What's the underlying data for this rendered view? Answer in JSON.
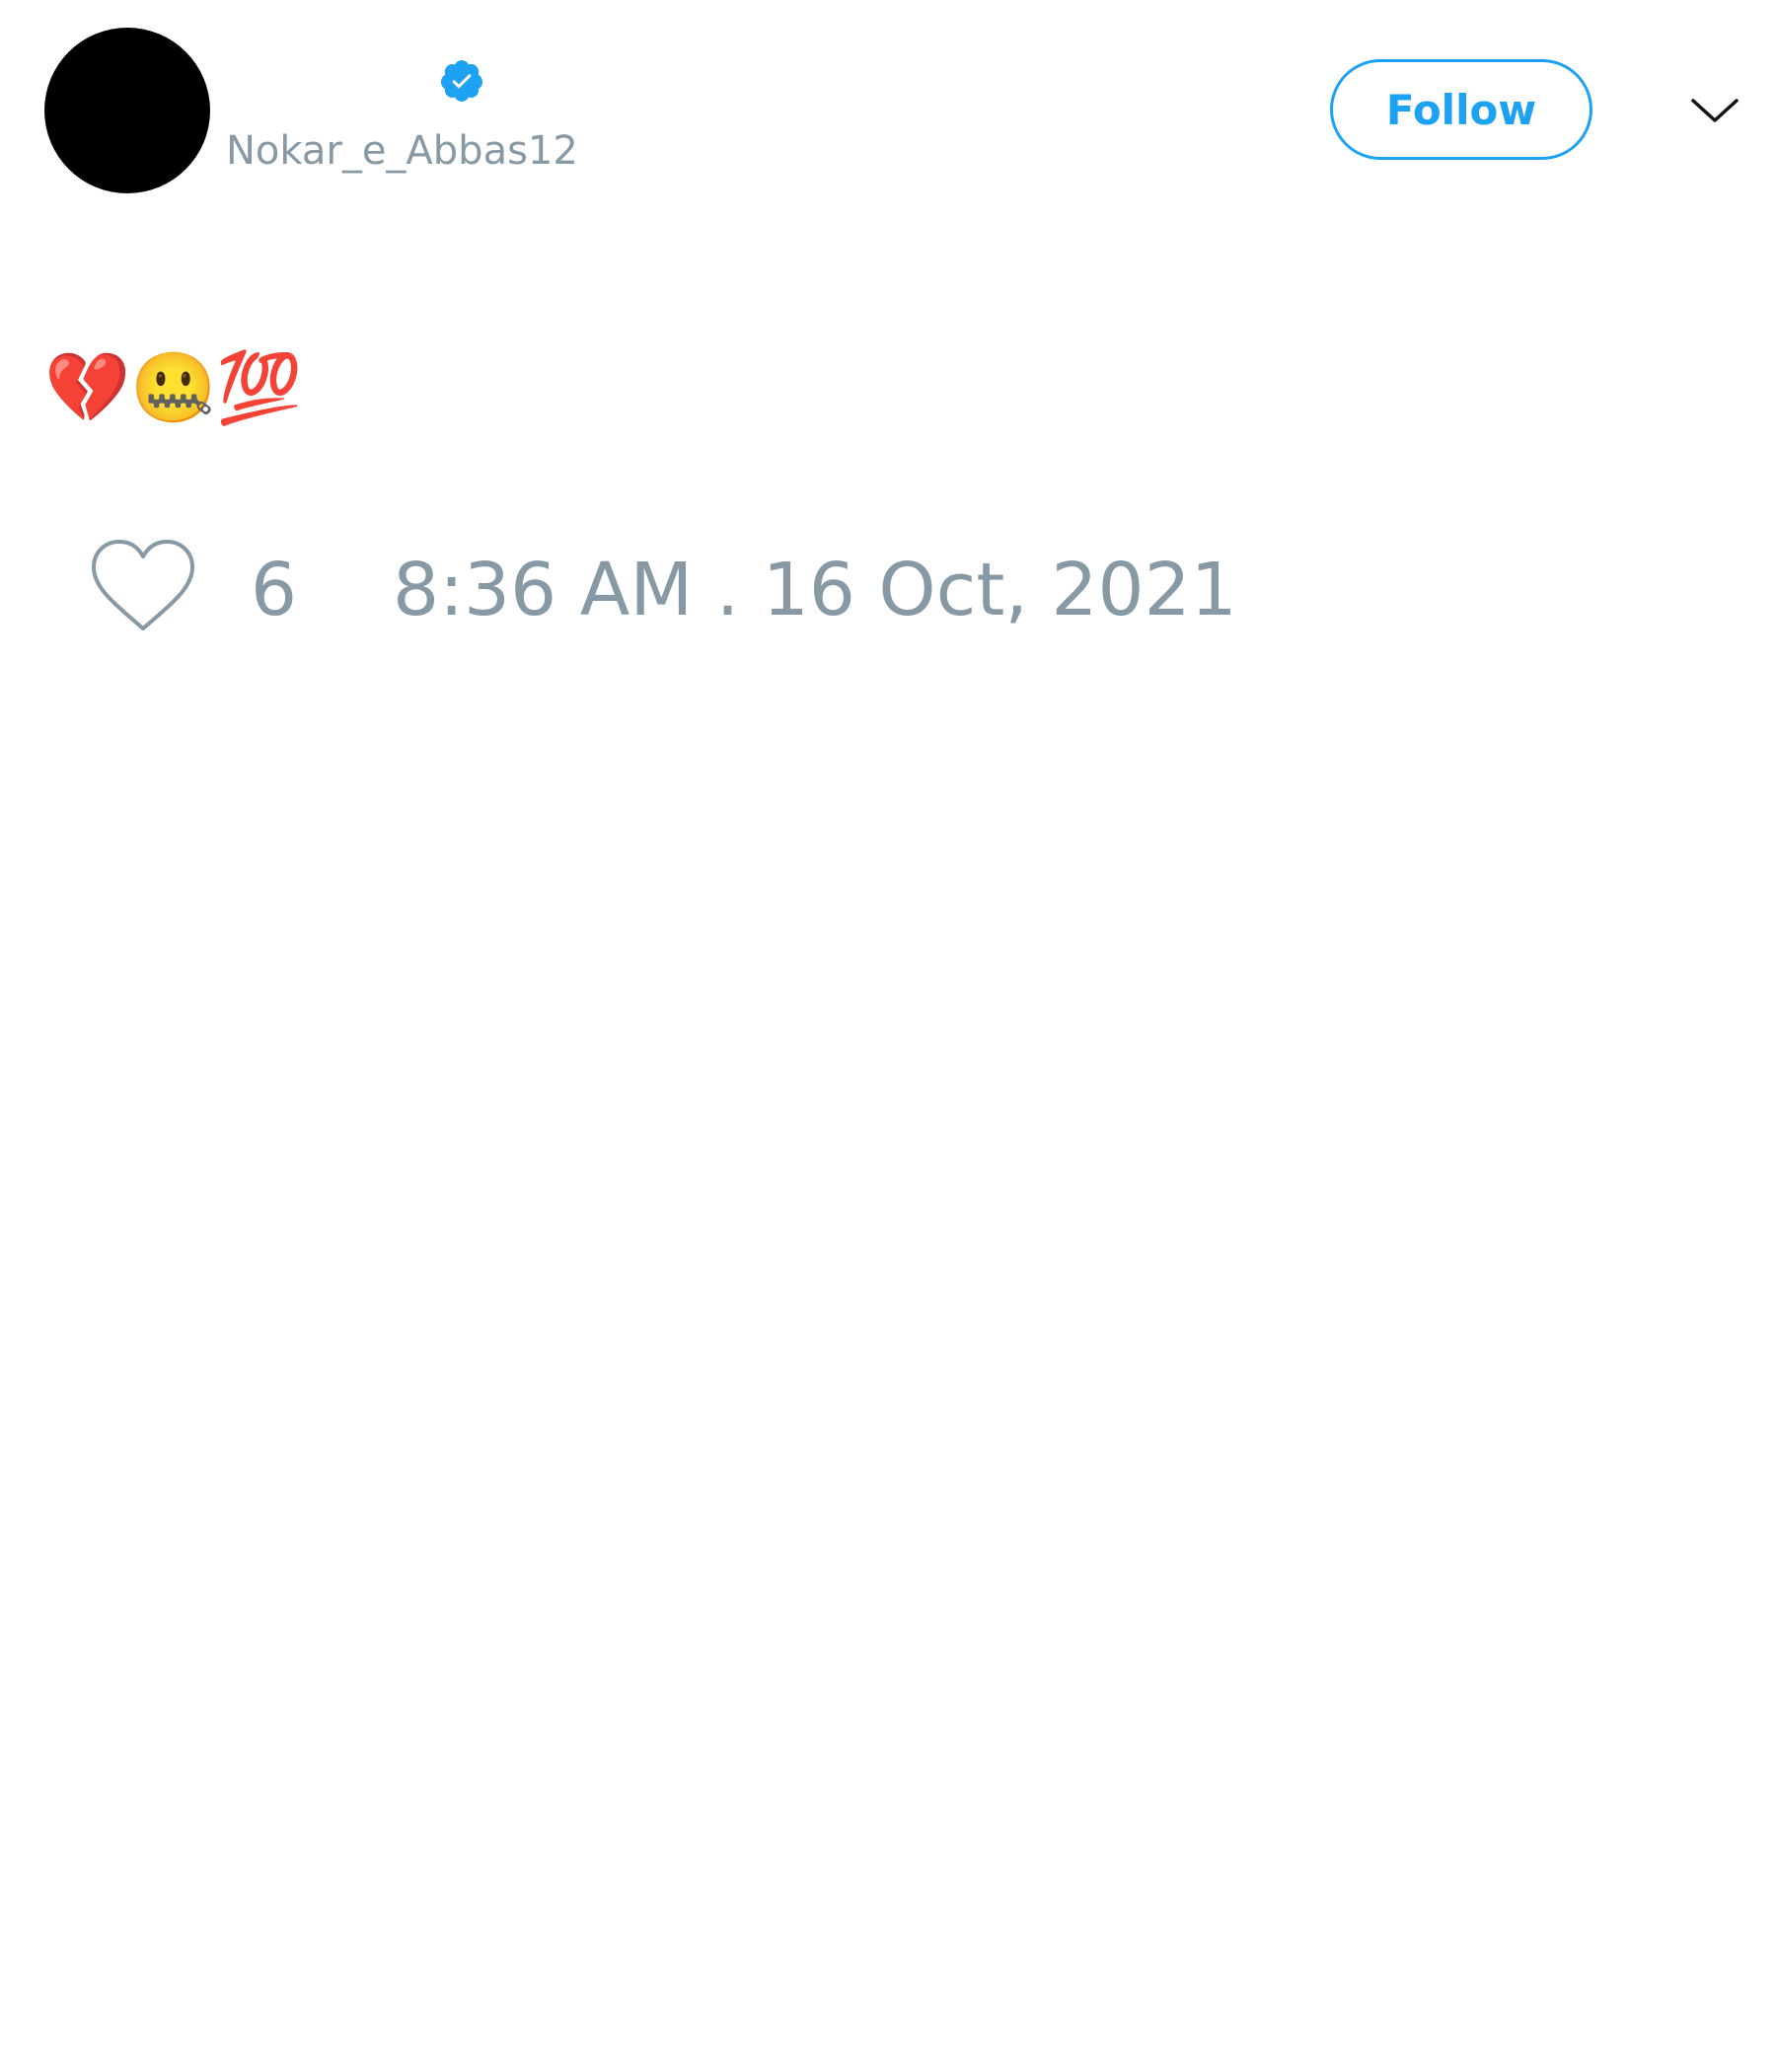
{
  "user": {
    "display_name": "",
    "handle": "Nokar_e_Abbas12",
    "verified": true,
    "avatar_color": "#000000",
    "verified_icon": "verified-badge-icon"
  },
  "actions": {
    "follow_label": "Follow",
    "menu_icon": "chevron-down-icon"
  },
  "tweet": {
    "text": "💔🤐💯"
  },
  "stats": {
    "like_icon": "heart-icon",
    "likes": "6",
    "timestamp": "8:36 AM . 16 Oct, 2021"
  },
  "colors": {
    "accent": "#1da1f2",
    "muted": "#8899a6",
    "text": "#0f1419",
    "background": "#ffffff"
  }
}
